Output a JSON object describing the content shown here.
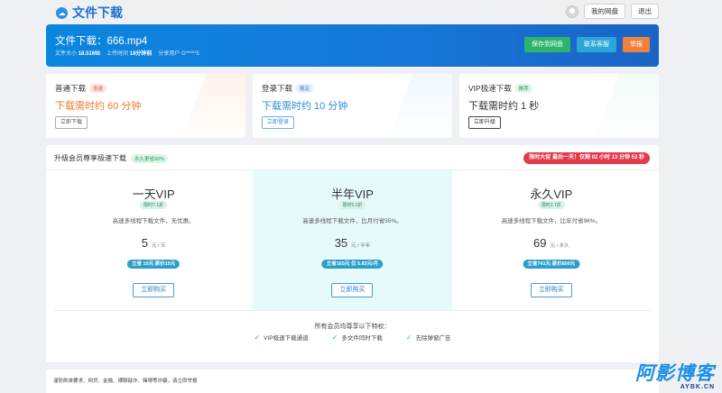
{
  "header": {
    "logo_glyph": "☁",
    "title": "文件下载",
    "my_disk_label": "我的网盘",
    "logout_label": "退出"
  },
  "file": {
    "title": "文件下载：666.mp4",
    "size_label": "文件大小",
    "size_value": "18.51MB",
    "upload_label": "上传时间",
    "upload_value": "18分钟前",
    "share_label": "分享用户",
    "share_value": "G*****5",
    "save_label": "保存到网盘",
    "support_label": "联系客服",
    "report_label": "举报"
  },
  "download_options": [
    {
      "title": "普通下载",
      "tag": "低速",
      "time": "下载需时约 60 分钟",
      "button": "立即下载"
    },
    {
      "title": "登录下载",
      "tag": "稳定",
      "time": "下载需时约 10 分钟",
      "button": "立即登录"
    },
    {
      "title": "VIP极速下载",
      "tag": "推荐",
      "time": "下载需时约 1 秒",
      "button": "立即升级"
    }
  ],
  "vip": {
    "heading": "升级会员尊享极速下载",
    "heading_tag": "永久更省90%",
    "promo": "限时大促 最后一天！仅剩 02 小时 13 分钟 53 秒",
    "plans": [
      {
        "name": "一天VIP",
        "badge": "限时7.1折",
        "desc": "高速多线程下载文件，无优惠。",
        "price": "5",
        "unit": "元 / 天",
        "save": "立省 10元 原价15元",
        "button": "立即购买"
      },
      {
        "name": "半年VIP",
        "badge": "限时5.2折",
        "desc": "高速多线程下载文件，比月付省55%。",
        "price": "35",
        "unit": "元 / 半年",
        "save": "立省165元 仅 5.83元/月",
        "button": "立即购买"
      },
      {
        "name": "永久VIP",
        "badge": "限时2.7折",
        "desc": "高速多线程下载文件，比年付省96%。",
        "price": "69",
        "unit": "元 / 永久",
        "save": "立省741元 原价800元",
        "button": "立即购买"
      }
    ],
    "perks_title": "所有会员均尊享以下特权：",
    "perks": [
      "VIP极速下载通道",
      "多文件同时下载",
      "去除弹窗广告"
    ]
  },
  "footer": {
    "text": "谨防刷单要求、网贷、金融、裸聊敲诈、赌博等诈骗，请立即举报"
  },
  "watermark": {
    "big": "阿影博客",
    "small": "AYBK.CN"
  },
  "colors": {
    "banner_blue": "#1677d6",
    "green": "#2db36b",
    "cyan": "#2ba6d6",
    "orange": "#f0803c",
    "promo_red": "#e33a4c"
  }
}
